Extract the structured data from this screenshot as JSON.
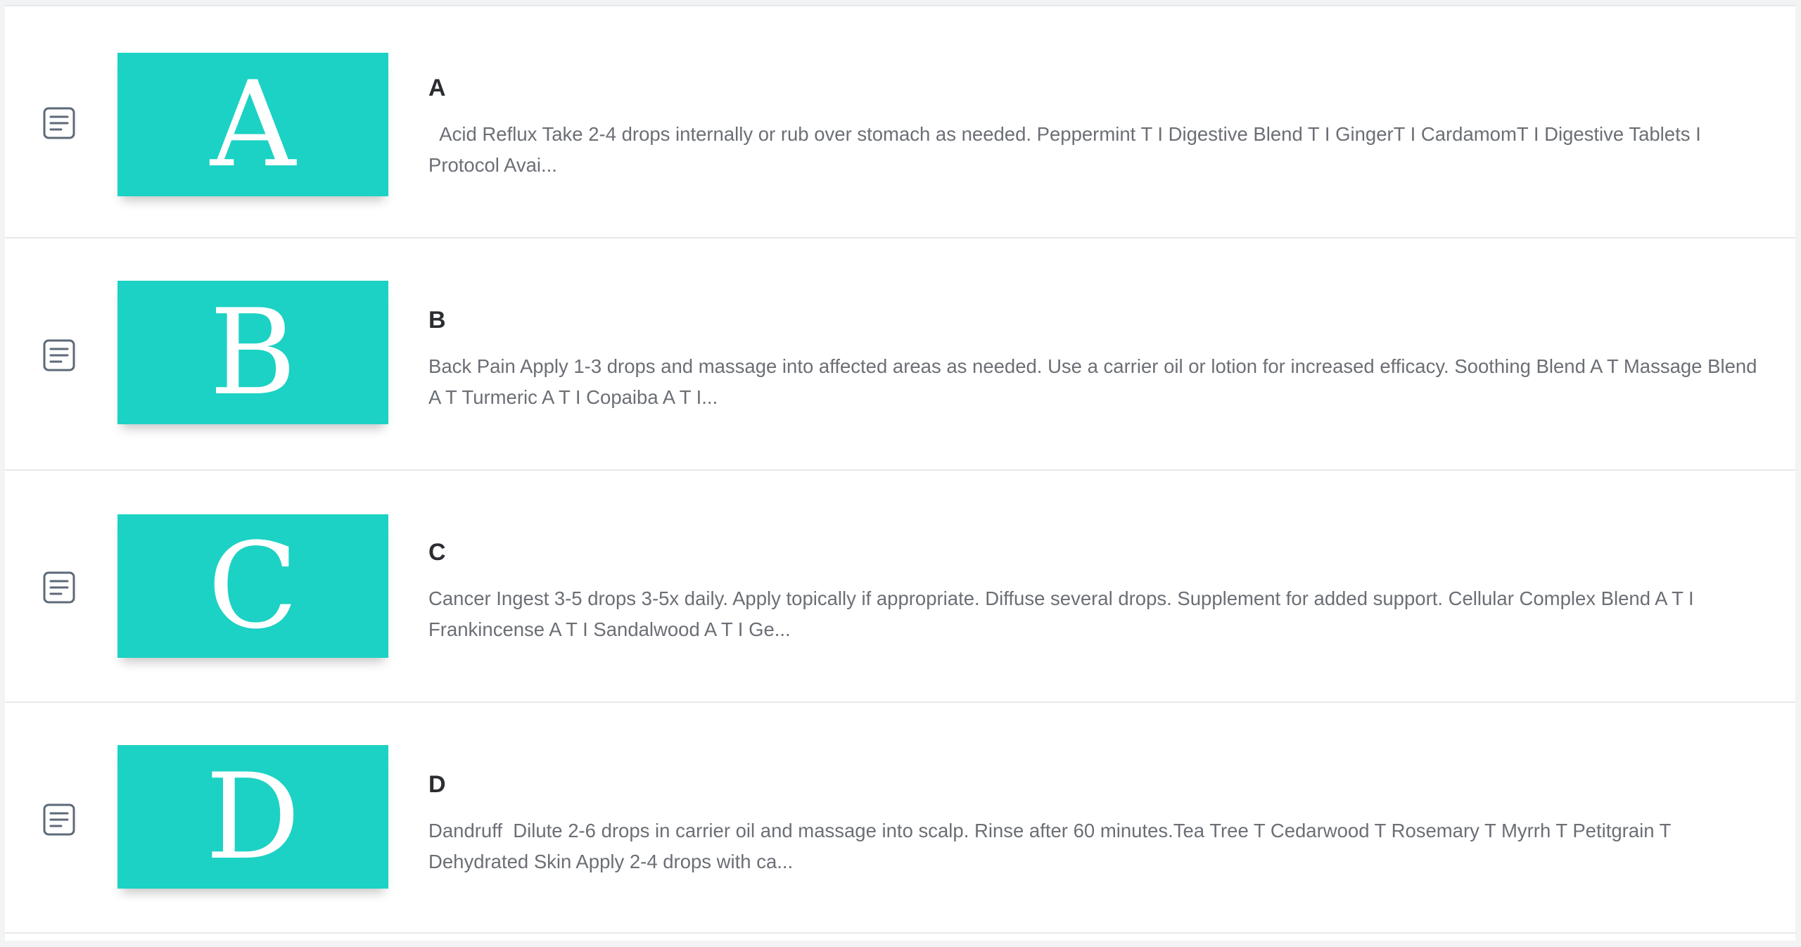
{
  "entries": [
    {
      "thumb_letter": "A",
      "title": "A",
      "excerpt": "  Acid Reflux Take 2-4 drops internally or rub over stomach as needed. Peppermint T I Digestive Blend T I GingerT I CardamomT I Digestive Tablets I Protocol Avai..."
    },
    {
      "thumb_letter": "B",
      "title": "B",
      "excerpt": "Back Pain Apply 1-3 drops and massage into affected areas as needed. Use a carrier oil or lotion for increased efficacy. Soothing Blend A T Massage Blend A T Turmeric A T I Copaiba A T I..."
    },
    {
      "thumb_letter": "C",
      "title": "C",
      "excerpt": "Cancer Ingest 3-5 drops 3-5x daily. Apply topically if appropriate. Diffuse several drops. Supplement for added support. Cellular Complex Blend A T I Frankincense A T I Sandalwood A T I Ge..."
    },
    {
      "thumb_letter": "D",
      "title": "D",
      "excerpt": "Dandruff  Dilute 2-6 drops in carrier oil and massage into scalp. Rinse after 60 minutes.Tea Tree T Cedarwood T Rosemary T Myrrh T Petitgrain T Dehydrated Skin Apply 2-4 drops with ca..."
    }
  ],
  "colors": {
    "thumb_background": "#1cd2c4",
    "title_text": "#2b2d33",
    "excerpt_text": "#6b6f75",
    "icon_stroke": "#5d6a78"
  },
  "icons": {
    "row_icon": "document-lines-icon"
  }
}
